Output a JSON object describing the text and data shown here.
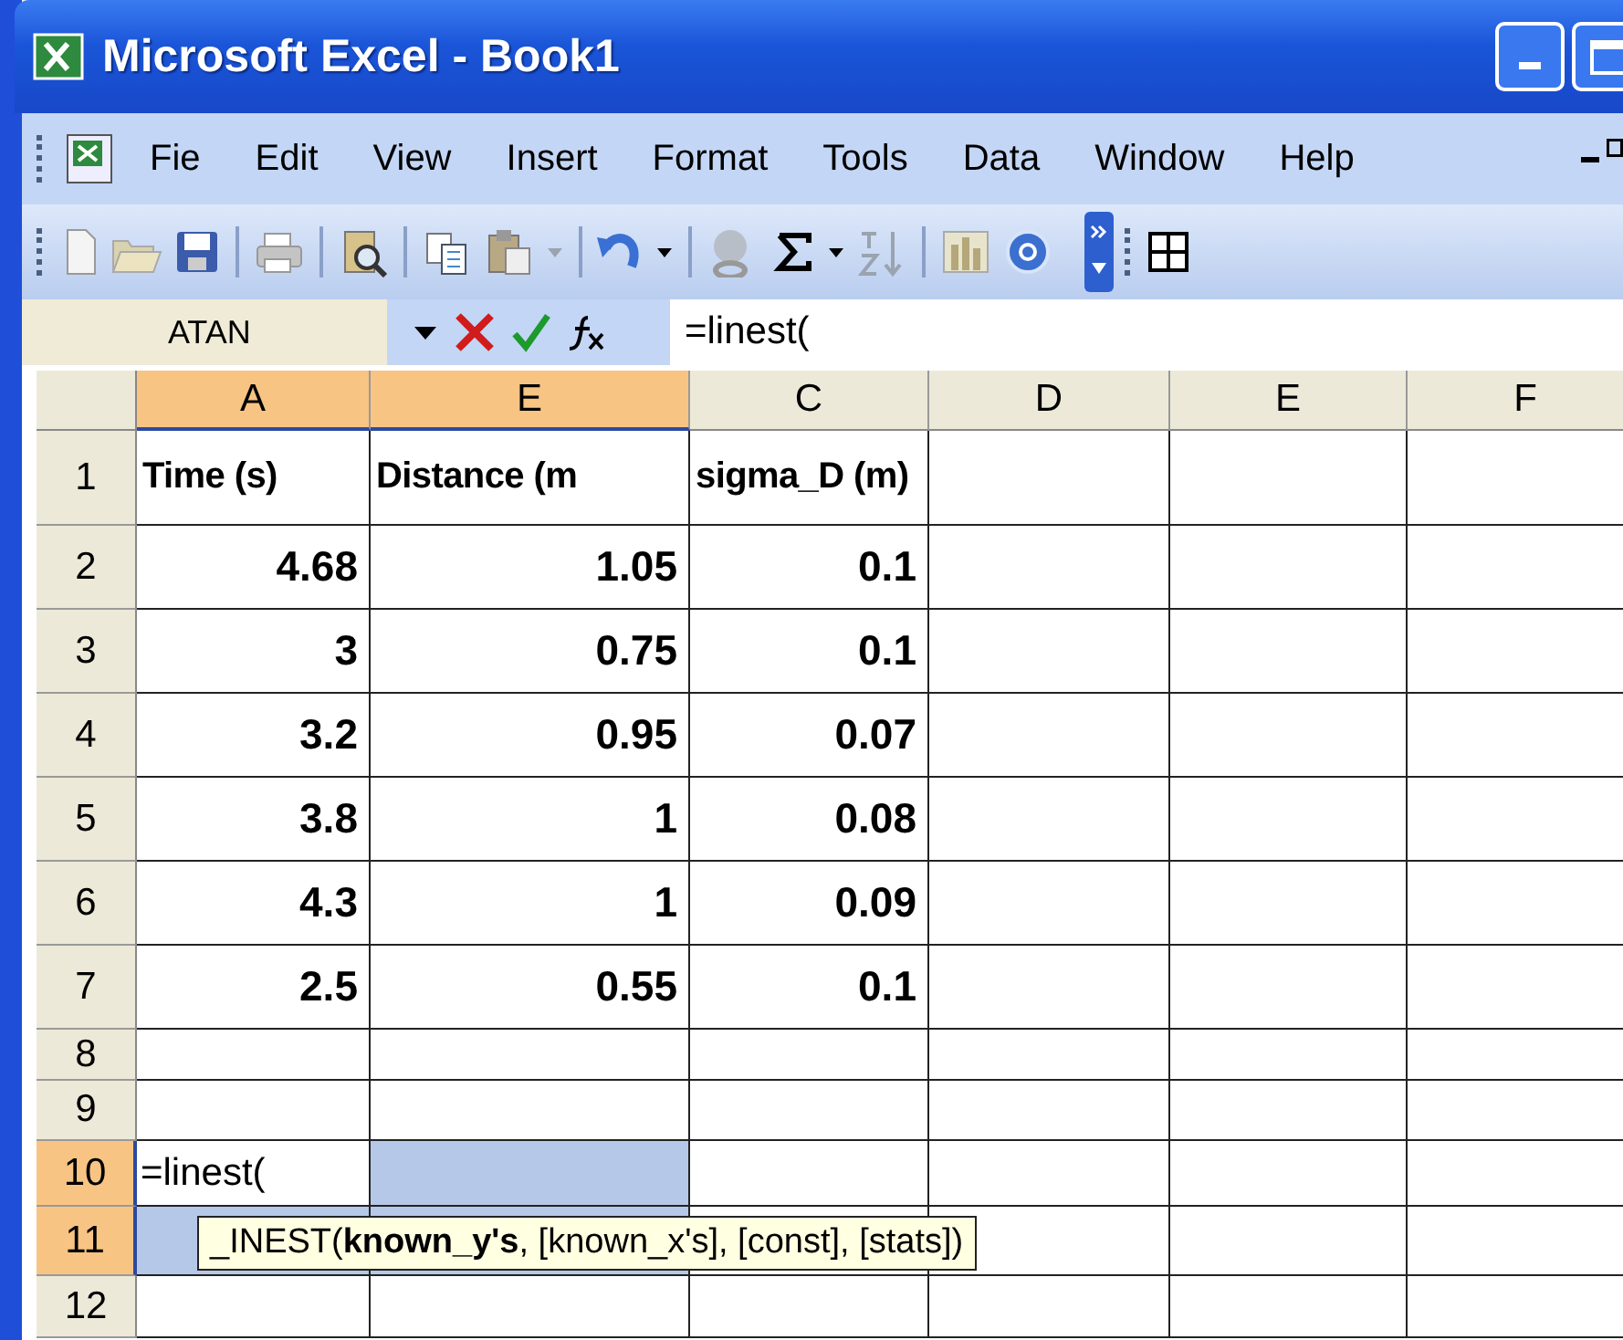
{
  "window": {
    "title": "Microsoft Excel - Book1"
  },
  "menu": [
    {
      "label": "Fie"
    },
    {
      "label": "Edit"
    },
    {
      "label": "View"
    },
    {
      "label": "Insert"
    },
    {
      "label": "Format"
    },
    {
      "label": "Tools"
    },
    {
      "label": "Data"
    },
    {
      "label": "Window"
    },
    {
      "label": "Help"
    }
  ],
  "formula_bar": {
    "name_box": "ATAN",
    "formula": "=linest("
  },
  "sheet": {
    "columns": [
      {
        "label": "A",
        "selected": true
      },
      {
        "label": "E",
        "selected": true
      },
      {
        "label": "C",
        "selected": false
      },
      {
        "label": "D",
        "selected": false
      },
      {
        "label": "E",
        "selected": false
      },
      {
        "label": "F",
        "selected": false
      }
    ],
    "rows": [
      {
        "header": "1",
        "selected": false,
        "cells": [
          {
            "text": "Time (s)",
            "kind": "heading",
            "selected": false
          },
          {
            "text": "Distance (m",
            "kind": "heading",
            "selected": false
          },
          {
            "text": "sigma_D (m)",
            "kind": "heading",
            "selected": false
          },
          {
            "selected": false
          },
          {
            "selected": false
          },
          {
            "selected": false
          }
        ]
      },
      {
        "header": "2",
        "selected": false,
        "cells": [
          {
            "text": "4.68",
            "kind": "number",
            "selected": false
          },
          {
            "text": "1.05",
            "kind": "number",
            "selected": false
          },
          {
            "text": "0.1",
            "kind": "number",
            "selected": false
          },
          {
            "selected": false
          },
          {
            "selected": false
          },
          {
            "selected": false
          }
        ]
      },
      {
        "header": "3",
        "selected": false,
        "cells": [
          {
            "text": "3",
            "kind": "number",
            "selected": false
          },
          {
            "text": "0.75",
            "kind": "number",
            "selected": false
          },
          {
            "text": "0.1",
            "kind": "number",
            "selected": false
          },
          {
            "selected": false
          },
          {
            "selected": false
          },
          {
            "selected": false
          }
        ]
      },
      {
        "header": "4",
        "selected": false,
        "cells": [
          {
            "text": "3.2",
            "kind": "number",
            "selected": false
          },
          {
            "text": "0.95",
            "kind": "number",
            "selected": false
          },
          {
            "text": "0.07",
            "kind": "number",
            "selected": false
          },
          {
            "selected": false
          },
          {
            "selected": false
          },
          {
            "selected": false
          }
        ]
      },
      {
        "header": "5",
        "selected": false,
        "cells": [
          {
            "text": "3.8",
            "kind": "number",
            "selected": false
          },
          {
            "text": "1",
            "kind": "number",
            "selected": false
          },
          {
            "text": "0.08",
            "kind": "number",
            "selected": false
          },
          {
            "selected": false
          },
          {
            "selected": false
          },
          {
            "selected": false
          }
        ]
      },
      {
        "header": "6",
        "selected": false,
        "cells": [
          {
            "text": "4.3",
            "kind": "number",
            "selected": false
          },
          {
            "text": "1",
            "kind": "number",
            "selected": false
          },
          {
            "text": "0.09",
            "kind": "number",
            "selected": false
          },
          {
            "selected": false
          },
          {
            "selected": false
          },
          {
            "selected": false
          }
        ]
      },
      {
        "header": "7",
        "selected": false,
        "cells": [
          {
            "text": "2.5",
            "kind": "number",
            "selected": false
          },
          {
            "text": "0.55",
            "kind": "number",
            "selected": false
          },
          {
            "text": "0.1",
            "kind": "number",
            "selected": false
          },
          {
            "selected": false
          },
          {
            "selected": false
          },
          {
            "selected": false
          }
        ]
      },
      {
        "header": "8",
        "selected": false,
        "cells": [
          {
            "selected": false
          },
          {
            "selected": false
          },
          {
            "selected": false
          },
          {
            "selected": false
          },
          {
            "selected": false
          },
          {
            "selected": false
          }
        ]
      },
      {
        "header": "9",
        "selected": false,
        "cells": [
          {
            "selected": false
          },
          {
            "selected": false
          },
          {
            "selected": false
          },
          {
            "selected": false
          },
          {
            "selected": false
          },
          {
            "selected": false
          }
        ]
      },
      {
        "header": "10",
        "selected": true,
        "cells": [
          {
            "text": "=linest(",
            "kind": "editing",
            "selected": false
          },
          {
            "selected": true
          },
          {
            "selected": false
          },
          {
            "selected": false
          },
          {
            "selected": false
          },
          {
            "selected": false
          }
        ]
      },
      {
        "header": "11",
        "selected": true,
        "cells": [
          {
            "selected": true
          },
          {
            "selected": true
          },
          {
            "selected": false
          },
          {
            "selected": false
          },
          {
            "selected": false
          },
          {
            "selected": false
          }
        ]
      },
      {
        "header": "12",
        "selected": false,
        "cells": [
          {
            "selected": false
          },
          {
            "selected": false
          },
          {
            "selected": false
          },
          {
            "selected": false
          },
          {
            "selected": false
          },
          {
            "selected": false
          }
        ]
      }
    ]
  },
  "tooltip": {
    "text": "_INEST(**known_y's**, [known_x's], [const], [stats])"
  }
}
